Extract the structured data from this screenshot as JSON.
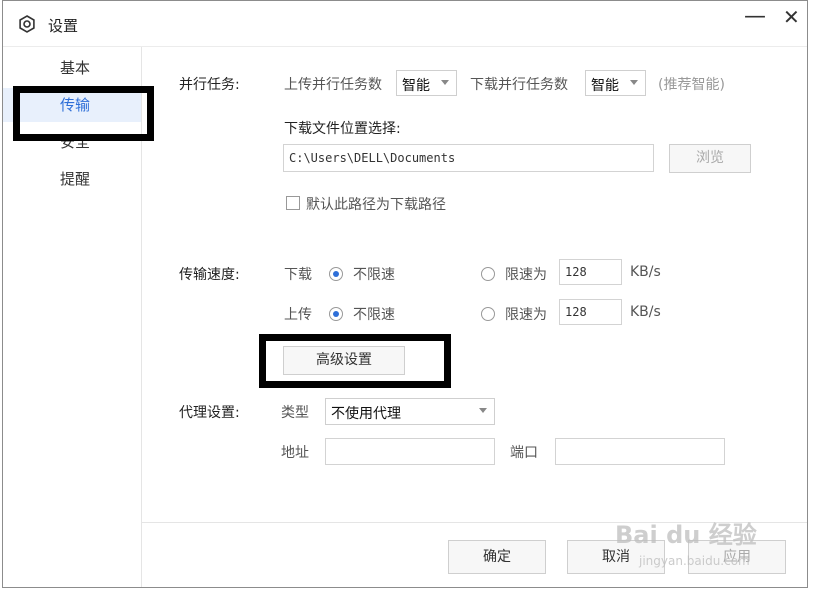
{
  "window": {
    "title": "设置",
    "minimize_glyph": "—",
    "close_glyph": "✕"
  },
  "sidebar": {
    "items": [
      {
        "label": "基本"
      },
      {
        "label": "传输"
      },
      {
        "label": "安全"
      },
      {
        "label": "提醒"
      }
    ]
  },
  "parallel": {
    "section_label": "并行任务:",
    "upload_label": "上传并行任务数",
    "upload_value": "智能",
    "download_label": "下载并行任务数",
    "download_value": "智能",
    "hint": "(推荐智能)"
  },
  "download_location": {
    "label": "下载文件位置选择:",
    "path": "C:\\Users\\DELL\\Documents",
    "browse_label": "浏览",
    "default_checkbox_label": "默认此路径为下载路径",
    "default_checked": false
  },
  "speed": {
    "section_label": "传输速度:",
    "download": {
      "label": "下载",
      "unlimited_label": "不限速",
      "limit_label": "限速为",
      "limit_value": "128",
      "unit": "KB/s",
      "selected": "unlimited"
    },
    "upload": {
      "label": "上传",
      "unlimited_label": "不限速",
      "limit_label": "限速为",
      "limit_value": "128",
      "unit": "KB/s",
      "selected": "unlimited"
    },
    "advanced_label": "高级设置"
  },
  "proxy": {
    "section_label": "代理设置:",
    "type_label": "类型",
    "type_value": "不使用代理",
    "address_label": "地址",
    "address_value": "",
    "port_label": "端口",
    "port_value": ""
  },
  "footer": {
    "ok_label": "确定",
    "cancel_label": "取消",
    "apply_label": "应用"
  },
  "watermark": {
    "text": "Bai du 经验",
    "sub": "jingyan.baidu.com"
  },
  "colors": {
    "accent": "#2e6fd8",
    "active_bg": "#e8f0fc",
    "annotation": "#000000"
  }
}
